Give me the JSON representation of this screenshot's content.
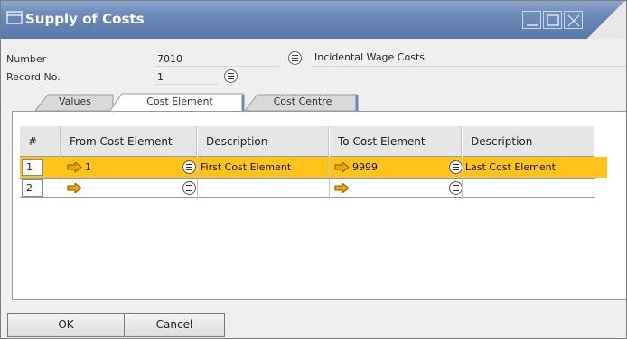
{
  "window": {
    "title": "Supply of Costs",
    "controls": [
      "minimize-icon",
      "maximize-icon",
      "close-icon"
    ]
  },
  "header": {
    "number_label": "Number",
    "number_value": "7010",
    "name_value": "Incidental Wage Costs",
    "record_label": "Record No.",
    "record_value": "1"
  },
  "tabs": [
    {
      "label": "Values",
      "active": false
    },
    {
      "label": "Cost Element",
      "active": true
    },
    {
      "label": "Cost Centre",
      "active": false
    }
  ],
  "grid": {
    "columns": [
      "#",
      "From Cost Element",
      "Description",
      "To Cost Element",
      "Description"
    ],
    "rows": [
      {
        "num": "1",
        "from": "1",
        "from_desc": "First Cost Element",
        "to": "9999",
        "to_desc": "Last Cost Element",
        "selected": true
      },
      {
        "num": "2",
        "from": "",
        "from_desc": "",
        "to": "",
        "to_desc": "",
        "selected": false
      }
    ]
  },
  "buttons": {
    "ok_label": "OK",
    "cancel_label": "Cancel"
  },
  "colors": {
    "title_bar": "#6a8ab8",
    "selected_row": "#ffc31a",
    "arrow": "#f5a800"
  }
}
